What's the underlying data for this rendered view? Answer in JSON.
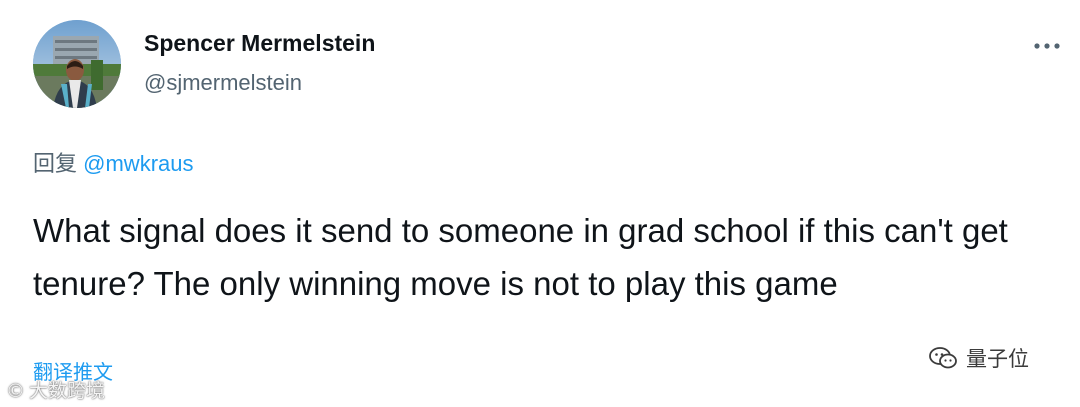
{
  "author": {
    "display_name": "Spencer Mermelstein",
    "handle": "@sjmermelstein"
  },
  "reply": {
    "prefix": "回复",
    "mention": "@mwkraus"
  },
  "tweet": {
    "text": "What signal does it send to someone in grad school if this can't get tenure? The only winning move is not to play this game"
  },
  "actions": {
    "translate_label": "翻译推文",
    "more_icon": "more-horizontal-icon"
  },
  "watermarks": {
    "left_symbol": "©",
    "left_text": "大数跨境",
    "right_text": "量子位"
  },
  "colors": {
    "link": "#1d9bf0",
    "secondary_text": "#536471",
    "primary_text": "#0f1419"
  }
}
